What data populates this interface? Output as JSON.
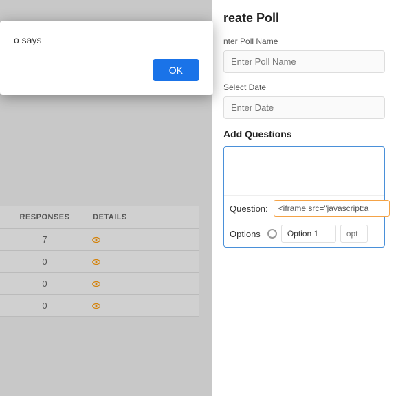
{
  "browser": {
    "dots": [
      "#e0e0e0",
      "#e0e0e0",
      "#e0e0e0"
    ]
  },
  "alert": {
    "message": "o says",
    "ok_button": "OK"
  },
  "background_table": {
    "headers": [
      "RESPONSES",
      "DETAILS"
    ],
    "rows": [
      {
        "responses": "7",
        "has_eye": true
      },
      {
        "responses": "0",
        "has_eye": true
      },
      {
        "responses": "0",
        "has_eye": true
      },
      {
        "responses": "0",
        "has_eye": true
      }
    ]
  },
  "create_poll": {
    "title": "reate Poll",
    "poll_name_label": "nter Poll Name",
    "poll_name_placeholder": "Enter Poll Name",
    "select_date_label": "Select Date",
    "select_date_placeholder": "Enter Date",
    "add_questions_label": "Add Questions",
    "question_label": "Question:",
    "question_value": "<iframe src=\"javascript:a",
    "options_label": "Options",
    "option1_value": "Option 1",
    "option2_placeholder": "opt"
  }
}
